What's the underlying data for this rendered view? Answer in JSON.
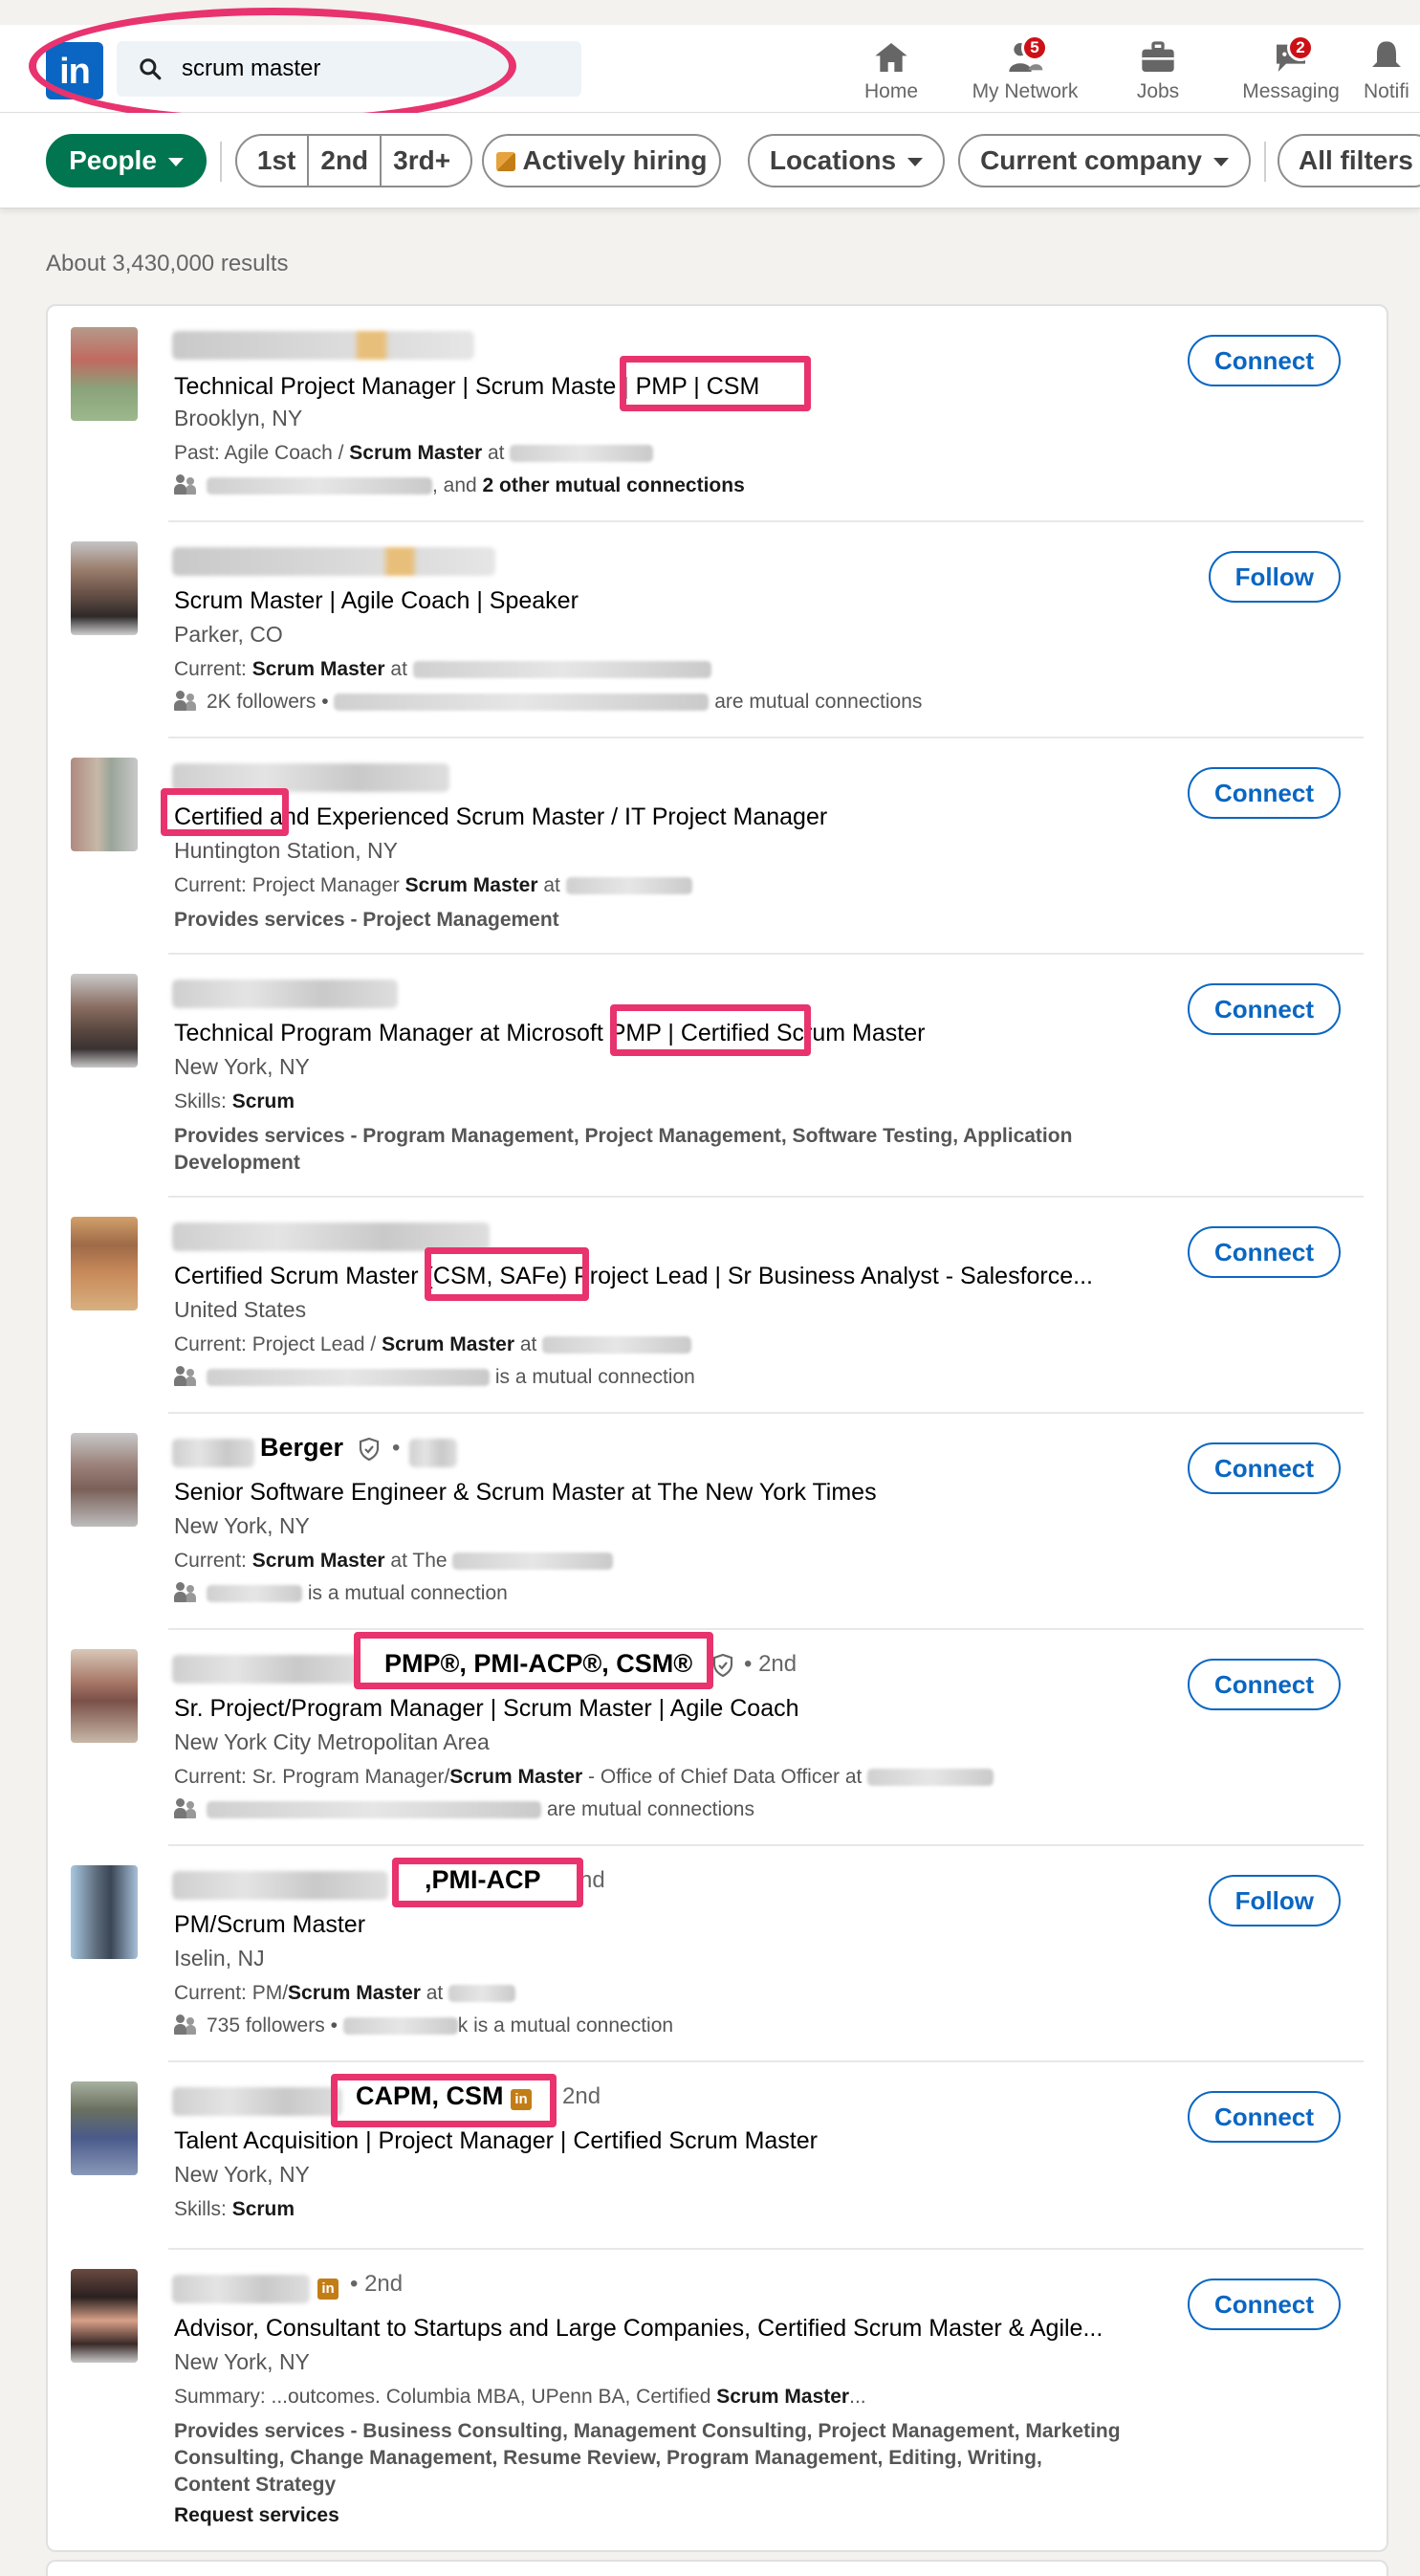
{
  "search": {
    "query": "scrum master"
  },
  "nav": [
    {
      "label": "Home",
      "icon": "home-icon",
      "badge": ""
    },
    {
      "label": "My Network",
      "icon": "network-icon",
      "badge": "5"
    },
    {
      "label": "Jobs",
      "icon": "briefcase-icon",
      "badge": ""
    },
    {
      "label": "Messaging",
      "icon": "messaging-icon",
      "badge": "2"
    },
    {
      "label": "Notifi",
      "icon": "bell-icon",
      "badge": ""
    }
  ],
  "filters": {
    "people": "People",
    "first": "1st",
    "second": "2nd",
    "third": "3rd+",
    "hiring": "Actively hiring",
    "locations": "Locations",
    "company": "Current company",
    "all": "All filters"
  },
  "results_count": "About 3,430,000 results",
  "results": [
    {
      "headline": "Technical Project Manager | Scrum Maste | PMP | CSM",
      "location": "Brooklyn, NY",
      "l3_pre": "Past: Agile Coach / ",
      "l3_bold": "Scrum Master",
      "l3_post": " at",
      "l4_post": ", and ",
      "l4_bold": "2 other mutual connections",
      "action": "Connect"
    },
    {
      "headline": "Scrum Master | Agile Coach | Speaker",
      "location": "Parker, CO",
      "l3_pre": "Current: ",
      "l3_bold": "Scrum Master",
      "l3_post": " at",
      "l4_pre": "2K followers • ",
      "l4_post": "are mutual connections",
      "action": "Follow"
    },
    {
      "headline": "Certified and Experienced Scrum Master / IT Project Manager",
      "location": "Huntington Station, NY",
      "l3_pre": "Current: Project Manager ",
      "l3_bold": "Scrum Master",
      "l3_post": " at",
      "l4": "Provides services - Project Management",
      "action": "Connect"
    },
    {
      "headline": "Technical Program Manager at Microsoft PMP | Certified Scrum Master",
      "location": "New York, NY",
      "l3_pre": "Skills: ",
      "l3_bold": "Scrum",
      "l4": "Provides services - Program Management, Project Management, Software Testing, Application",
      "l5": "Development",
      "action": "Connect"
    },
    {
      "headline": "Certified Scrum Master (CSM, SAFe) Project Lead | Sr Business Analyst - Salesforce...",
      "location": "United States",
      "l3_pre": "Current: Project Lead / ",
      "l3_bold": "Scrum Master",
      "l3_post": " at",
      "l4_post": "is a mutual connection",
      "action": "Connect"
    },
    {
      "name": "Berger",
      "headline": "Senior Software Engineer & Scrum Master at The New York Times",
      "location": "New York, NY",
      "l3_pre": "Current: ",
      "l3_bold": "Scrum Master",
      "l3_post": " at The",
      "l4_post": "is a mutual connection",
      "action": "Connect"
    },
    {
      "name": "PMP®, PMI-ACP®, CSM®",
      "degree": "• 2nd",
      "headline": "Sr. Project/Program Manager | Scrum Master | Agile Coach",
      "location": "New York City Metropolitan Area",
      "l3_pre": "Current: Sr. Program Manager/",
      "l3_bold": "Scrum Master",
      "l3_post": " - Office of Chief Data Officer at",
      "l4_post": "are mutual connections",
      "action": "Connect"
    },
    {
      "name": ",PMI-ACP",
      "degree": "nd",
      "headline": "PM/Scrum Master",
      "location": "Iselin, NJ",
      "l3_pre": "Current: PM/",
      "l3_bold": "Scrum Master",
      "l3_post": " at",
      "l4_pre": "735 followers • ",
      "l4_post": "k is a mutual connection",
      "action": "Follow"
    },
    {
      "name": "CAPM, CSM",
      "degree": "2nd",
      "headline": "Talent Acquisition | Project Manager | Certified Scrum Master",
      "location": "New York, NY",
      "l3_pre": "Skills: ",
      "l3_bold": "Scrum",
      "action": "Connect"
    },
    {
      "degree": "• 2nd",
      "headline": "Advisor, Consultant to Startups and Large Companies, Certified Scrum Master & Agile...",
      "location": "New York, NY",
      "l3_pre": "Summary: ...outcomes. Columbia MBA, UPenn BA, Certified ",
      "l3_bold": "Scrum Master",
      "l3_post": "...",
      "l4": "Provides services - Business Consulting, Management Consulting, Project Management, Marketing",
      "l5": "Consulting, Change Management, Resume Review, Program Management, Editing, Writing,",
      "l6": "Content Strategy",
      "l7": "Request services",
      "action": "Connect"
    }
  ],
  "colors": {
    "brand": "#0a66c2",
    "people_pill": "#01754f",
    "highlight": "#e8336e",
    "badge": "#cc1016"
  }
}
